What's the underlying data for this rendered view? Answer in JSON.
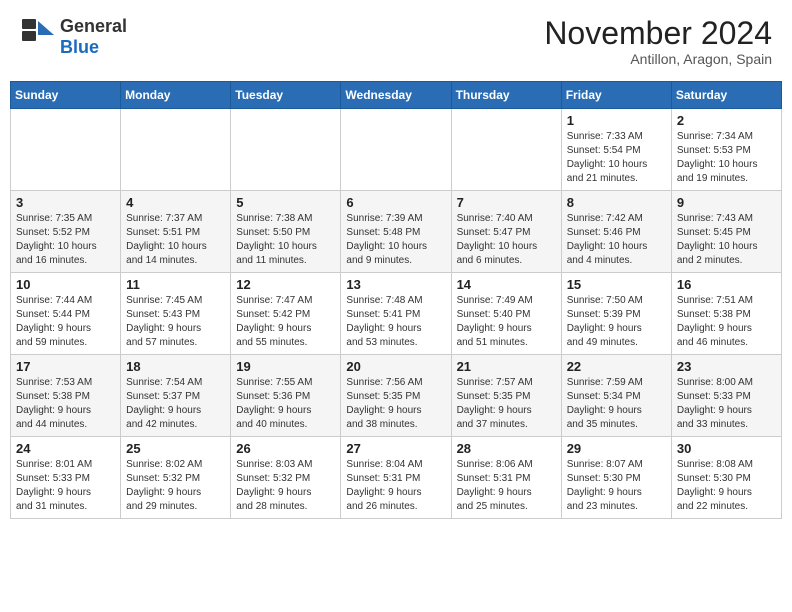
{
  "header": {
    "logo_general": "General",
    "logo_blue": "Blue",
    "month": "November 2024",
    "location": "Antillon, Aragon, Spain"
  },
  "days_of_week": [
    "Sunday",
    "Monday",
    "Tuesday",
    "Wednesday",
    "Thursday",
    "Friday",
    "Saturday"
  ],
  "weeks": [
    [
      {
        "day": "",
        "info": ""
      },
      {
        "day": "",
        "info": ""
      },
      {
        "day": "",
        "info": ""
      },
      {
        "day": "",
        "info": ""
      },
      {
        "day": "",
        "info": ""
      },
      {
        "day": "1",
        "info": "Sunrise: 7:33 AM\nSunset: 5:54 PM\nDaylight: 10 hours\nand 21 minutes."
      },
      {
        "day": "2",
        "info": "Sunrise: 7:34 AM\nSunset: 5:53 PM\nDaylight: 10 hours\nand 19 minutes."
      }
    ],
    [
      {
        "day": "3",
        "info": "Sunrise: 7:35 AM\nSunset: 5:52 PM\nDaylight: 10 hours\nand 16 minutes."
      },
      {
        "day": "4",
        "info": "Sunrise: 7:37 AM\nSunset: 5:51 PM\nDaylight: 10 hours\nand 14 minutes."
      },
      {
        "day": "5",
        "info": "Sunrise: 7:38 AM\nSunset: 5:50 PM\nDaylight: 10 hours\nand 11 minutes."
      },
      {
        "day": "6",
        "info": "Sunrise: 7:39 AM\nSunset: 5:48 PM\nDaylight: 10 hours\nand 9 minutes."
      },
      {
        "day": "7",
        "info": "Sunrise: 7:40 AM\nSunset: 5:47 PM\nDaylight: 10 hours\nand 6 minutes."
      },
      {
        "day": "8",
        "info": "Sunrise: 7:42 AM\nSunset: 5:46 PM\nDaylight: 10 hours\nand 4 minutes."
      },
      {
        "day": "9",
        "info": "Sunrise: 7:43 AM\nSunset: 5:45 PM\nDaylight: 10 hours\nand 2 minutes."
      }
    ],
    [
      {
        "day": "10",
        "info": "Sunrise: 7:44 AM\nSunset: 5:44 PM\nDaylight: 9 hours\nand 59 minutes."
      },
      {
        "day": "11",
        "info": "Sunrise: 7:45 AM\nSunset: 5:43 PM\nDaylight: 9 hours\nand 57 minutes."
      },
      {
        "day": "12",
        "info": "Sunrise: 7:47 AM\nSunset: 5:42 PM\nDaylight: 9 hours\nand 55 minutes."
      },
      {
        "day": "13",
        "info": "Sunrise: 7:48 AM\nSunset: 5:41 PM\nDaylight: 9 hours\nand 53 minutes."
      },
      {
        "day": "14",
        "info": "Sunrise: 7:49 AM\nSunset: 5:40 PM\nDaylight: 9 hours\nand 51 minutes."
      },
      {
        "day": "15",
        "info": "Sunrise: 7:50 AM\nSunset: 5:39 PM\nDaylight: 9 hours\nand 49 minutes."
      },
      {
        "day": "16",
        "info": "Sunrise: 7:51 AM\nSunset: 5:38 PM\nDaylight: 9 hours\nand 46 minutes."
      }
    ],
    [
      {
        "day": "17",
        "info": "Sunrise: 7:53 AM\nSunset: 5:38 PM\nDaylight: 9 hours\nand 44 minutes."
      },
      {
        "day": "18",
        "info": "Sunrise: 7:54 AM\nSunset: 5:37 PM\nDaylight: 9 hours\nand 42 minutes."
      },
      {
        "day": "19",
        "info": "Sunrise: 7:55 AM\nSunset: 5:36 PM\nDaylight: 9 hours\nand 40 minutes."
      },
      {
        "day": "20",
        "info": "Sunrise: 7:56 AM\nSunset: 5:35 PM\nDaylight: 9 hours\nand 38 minutes."
      },
      {
        "day": "21",
        "info": "Sunrise: 7:57 AM\nSunset: 5:35 PM\nDaylight: 9 hours\nand 37 minutes."
      },
      {
        "day": "22",
        "info": "Sunrise: 7:59 AM\nSunset: 5:34 PM\nDaylight: 9 hours\nand 35 minutes."
      },
      {
        "day": "23",
        "info": "Sunrise: 8:00 AM\nSunset: 5:33 PM\nDaylight: 9 hours\nand 33 minutes."
      }
    ],
    [
      {
        "day": "24",
        "info": "Sunrise: 8:01 AM\nSunset: 5:33 PM\nDaylight: 9 hours\nand 31 minutes."
      },
      {
        "day": "25",
        "info": "Sunrise: 8:02 AM\nSunset: 5:32 PM\nDaylight: 9 hours\nand 29 minutes."
      },
      {
        "day": "26",
        "info": "Sunrise: 8:03 AM\nSunset: 5:32 PM\nDaylight: 9 hours\nand 28 minutes."
      },
      {
        "day": "27",
        "info": "Sunrise: 8:04 AM\nSunset: 5:31 PM\nDaylight: 9 hours\nand 26 minutes."
      },
      {
        "day": "28",
        "info": "Sunrise: 8:06 AM\nSunset: 5:31 PM\nDaylight: 9 hours\nand 25 minutes."
      },
      {
        "day": "29",
        "info": "Sunrise: 8:07 AM\nSunset: 5:30 PM\nDaylight: 9 hours\nand 23 minutes."
      },
      {
        "day": "30",
        "info": "Sunrise: 8:08 AM\nSunset: 5:30 PM\nDaylight: 9 hours\nand 22 minutes."
      }
    ]
  ]
}
